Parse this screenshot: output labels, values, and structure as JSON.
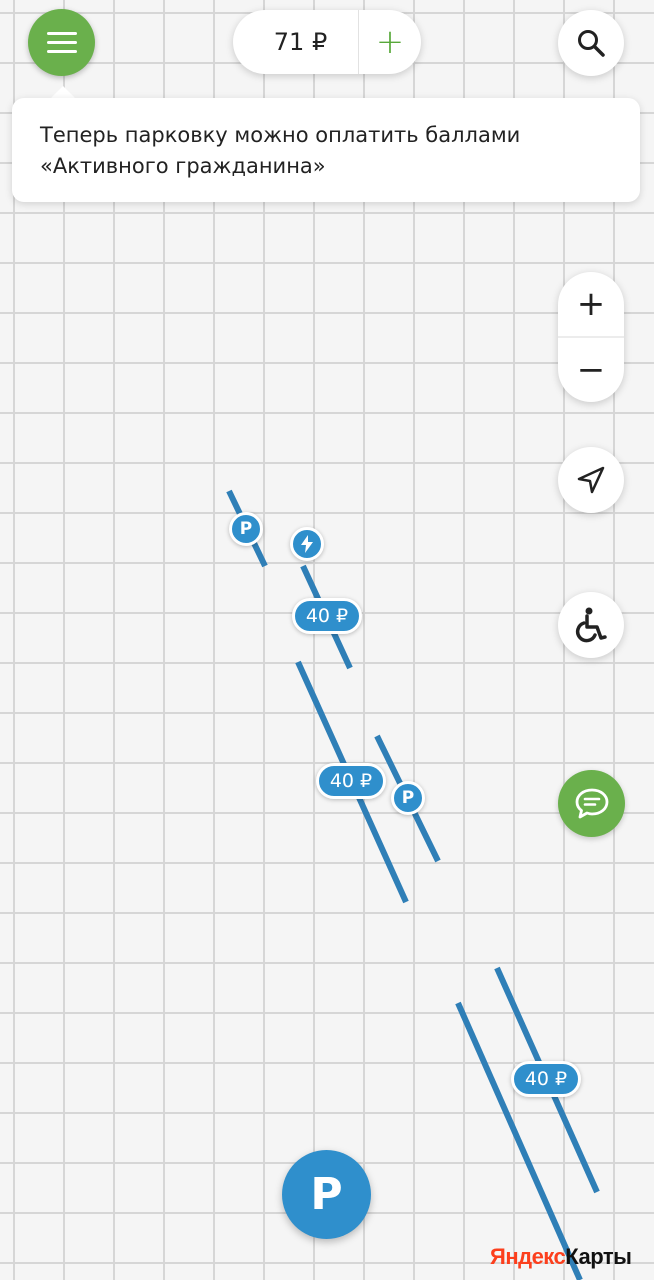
{
  "header": {
    "balance": "71 ₽",
    "add_label": "+"
  },
  "notification": {
    "text": "Теперь парковку можно оплатить баллами «Активного гражданина»"
  },
  "zoom": {
    "in_label": "+",
    "out_label": "−"
  },
  "map": {
    "zone_color": "#2f8fcc",
    "price_tags": [
      "40 ₽",
      "40 ₽",
      "40 ₽"
    ],
    "parking_marker_label": "P",
    "charging_marker_icon": "lightning-icon"
  },
  "fab": {
    "label": "P"
  },
  "logo": {
    "part1": "Яндекс",
    "part2": "Карты"
  },
  "colors": {
    "accent_green": "#6ab04c",
    "parking_blue": "#2f8fcc",
    "logo_red": "#fc3f1d"
  },
  "icons": [
    "menu-icon",
    "search-icon",
    "plus-icon",
    "minus-icon",
    "navigation-arrow-icon",
    "wheelchair-icon",
    "chat-icon"
  ]
}
